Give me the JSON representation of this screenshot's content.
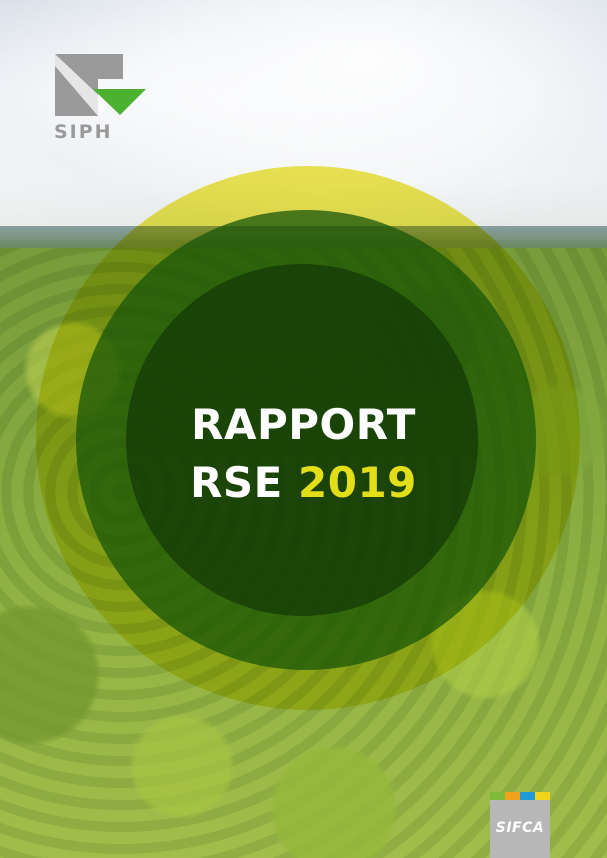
{
  "cover": {
    "title_line1": "RAPPORT",
    "title_line2_prefix": "RSE ",
    "title_year": "2019"
  },
  "logos": {
    "siph": {
      "label": "SIPH",
      "colors": {
        "gray": "#9a9a9a",
        "green": "#4bb12e"
      }
    },
    "sifca": {
      "label": "SIFCA",
      "stripe_colors": [
        "#7dbb39",
        "#f0a21a",
        "#1f9ad6",
        "#f0d31a"
      ]
    }
  },
  "colors": {
    "year_accent": "#e2df18",
    "outer_circle": "#e8dc00",
    "inner_circle": "#18560a"
  }
}
